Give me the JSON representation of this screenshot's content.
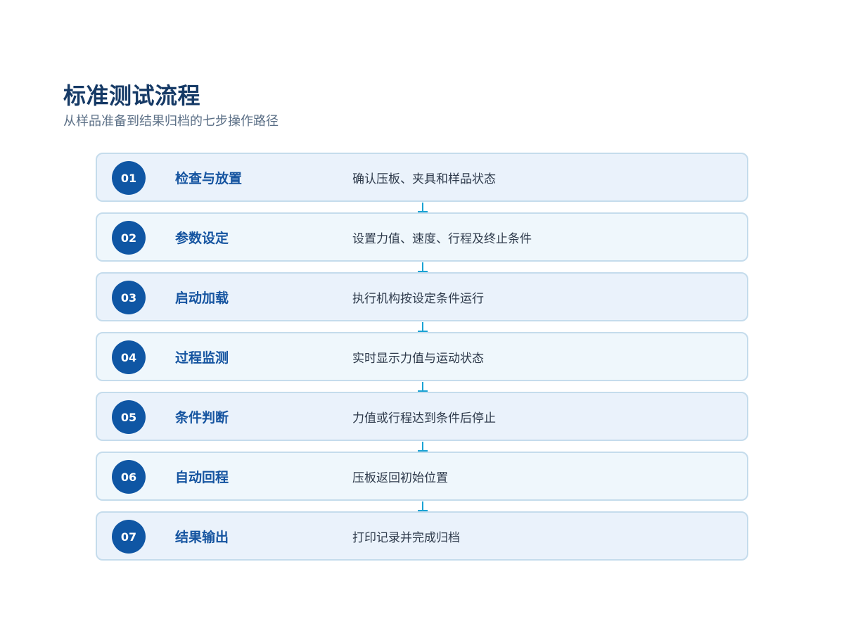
{
  "header": {
    "title": "标准测试流程",
    "subtitle": "从样品准备到结果归档的七步操作路径"
  },
  "steps": [
    {
      "num": "01",
      "title": "检查与放置",
      "desc": "确认压板、夹具和样品状态"
    },
    {
      "num": "02",
      "title": "参数设定",
      "desc": "设置力值、速度、行程及终止条件"
    },
    {
      "num": "03",
      "title": "启动加载",
      "desc": "执行机构按设定条件运行"
    },
    {
      "num": "04",
      "title": "过程监测",
      "desc": "实时显示力值与运动状态"
    },
    {
      "num": "05",
      "title": "条件判断",
      "desc": "力值或行程达到条件后停止"
    },
    {
      "num": "06",
      "title": "自动回程",
      "desc": "压板返回初始位置"
    },
    {
      "num": "07",
      "title": "结果输出",
      "desc": "打印记录并完成归档"
    }
  ],
  "colors": {
    "accent": "#0f56a4",
    "title": "#163a66",
    "connector": "#1aa3d4",
    "card_border": "#c5dcec"
  }
}
